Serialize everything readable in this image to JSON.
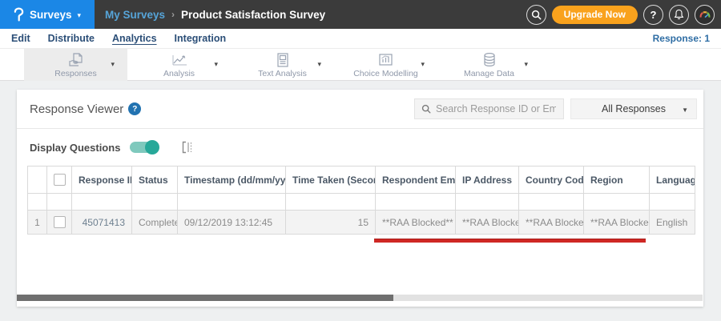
{
  "colors": {
    "accent_blue": "#1b87e6",
    "brand_orange": "#f9a21d",
    "toggle_teal": "#27a899",
    "annotation_red": "#cf2824",
    "header_dark": "#3b3b3b"
  },
  "header": {
    "product_menu": "Surveys",
    "menu_caret": "▾",
    "breadcrumb_parent": "My Surveys",
    "breadcrumb_separator": "›",
    "breadcrumb_current": "Product Satisfaction Survey",
    "upgrade_button": "Upgrade Now",
    "help_glyph": "?"
  },
  "nav": {
    "items": [
      {
        "label": "Edit"
      },
      {
        "label": "Distribute"
      },
      {
        "label": "Analytics"
      },
      {
        "label": "Integration"
      }
    ],
    "response_count": "Response: 1"
  },
  "toolbar": {
    "caret": "▾",
    "items": [
      {
        "label": "Responses"
      },
      {
        "label": "Analysis"
      },
      {
        "label": "Text Analysis"
      },
      {
        "label": "Choice Modelling"
      },
      {
        "label": "Manage Data"
      }
    ]
  },
  "panel": {
    "title": "Response Viewer",
    "help_glyph": "?",
    "search_placeholder": "Search Response ID or Email",
    "responses_filter": "All Responses",
    "filter_caret": "▼",
    "display_questions": "Display Questions"
  },
  "table": {
    "sort_glyph": "⇅",
    "sort_caret": "▼",
    "columns": {
      "response_id": "Response ID",
      "status": "Status",
      "timestamp": "Timestamp (dd/mm/yyyy)",
      "time_taken": "Time Taken (Seconds)",
      "respondent_email": "Respondent Email",
      "ip_address": "IP Address",
      "country_code": "Country Code",
      "region": "Region",
      "language": "Language"
    },
    "row": {
      "index": "1",
      "response_id": "45071413",
      "status": "Completed",
      "timestamp": "09/12/2019 13:12:45",
      "time_taken": "15",
      "respondent_email": "**RAA Blocked**",
      "ip_address": "**RAA Blocked**",
      "country_code": "**RAA Blocked**",
      "region": "**RAA Blocked**",
      "language": "English"
    }
  }
}
